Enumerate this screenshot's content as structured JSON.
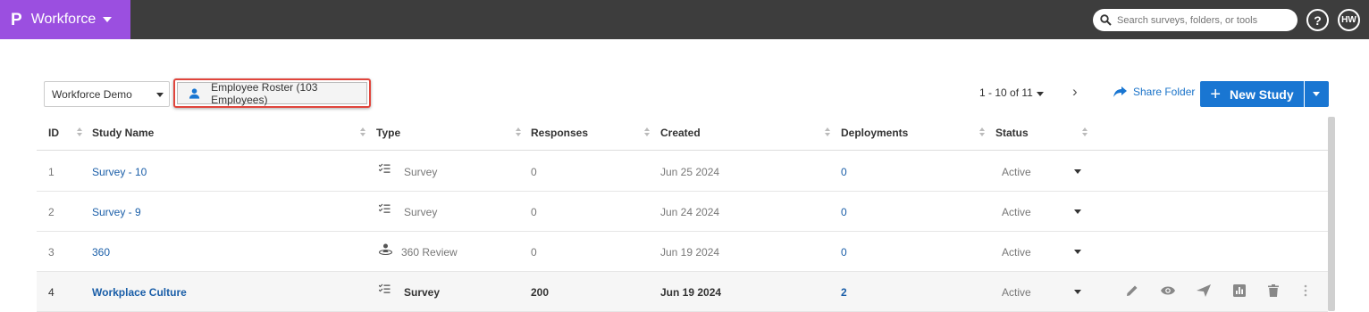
{
  "app": {
    "logo": "P",
    "name": "Workforce"
  },
  "search": {
    "placeholder": "Search surveys, folders, or tools"
  },
  "header": {
    "help_label": "?",
    "avatar_initials": "HW"
  },
  "toolbar": {
    "folder_select": "Workforce Demo",
    "roster_label": "Employee Roster (103 Employees)",
    "pagination": "1 - 10 of 11",
    "share_label": "Share Folder",
    "new_study_label": "New Study"
  },
  "table": {
    "columns": [
      "ID",
      "Study Name",
      "Type",
      "Responses",
      "Created",
      "Deployments",
      "Status"
    ],
    "rows": [
      {
        "id": "1",
        "name": "Survey - 10",
        "type": "Survey",
        "type_icon": "checklist-icon",
        "responses": "0",
        "created": "Jun 25 2024",
        "deployments": "0",
        "status": "Active"
      },
      {
        "id": "2",
        "name": "Survey - 9",
        "type": "Survey",
        "type_icon": "checklist-icon",
        "responses": "0",
        "created": "Jun 24 2024",
        "deployments": "0",
        "status": "Active"
      },
      {
        "id": "3",
        "name": "360",
        "type": "360 Review",
        "type_icon": "person-360-icon",
        "responses": "0",
        "created": "Jun 19 2024",
        "deployments": "0",
        "status": "Active"
      },
      {
        "id": "4",
        "name": "Workplace Culture",
        "type": "Survey",
        "type_icon": "checklist-icon",
        "responses": "200",
        "created": "Jun 19 2024",
        "deployments": "2",
        "status": "Active"
      }
    ]
  },
  "colors": {
    "brand": "#9b4fe0",
    "topbar": "#3d3d3d",
    "primary": "#1976d2",
    "link": "#1a5ea8",
    "highlight_border": "#e0453c"
  }
}
